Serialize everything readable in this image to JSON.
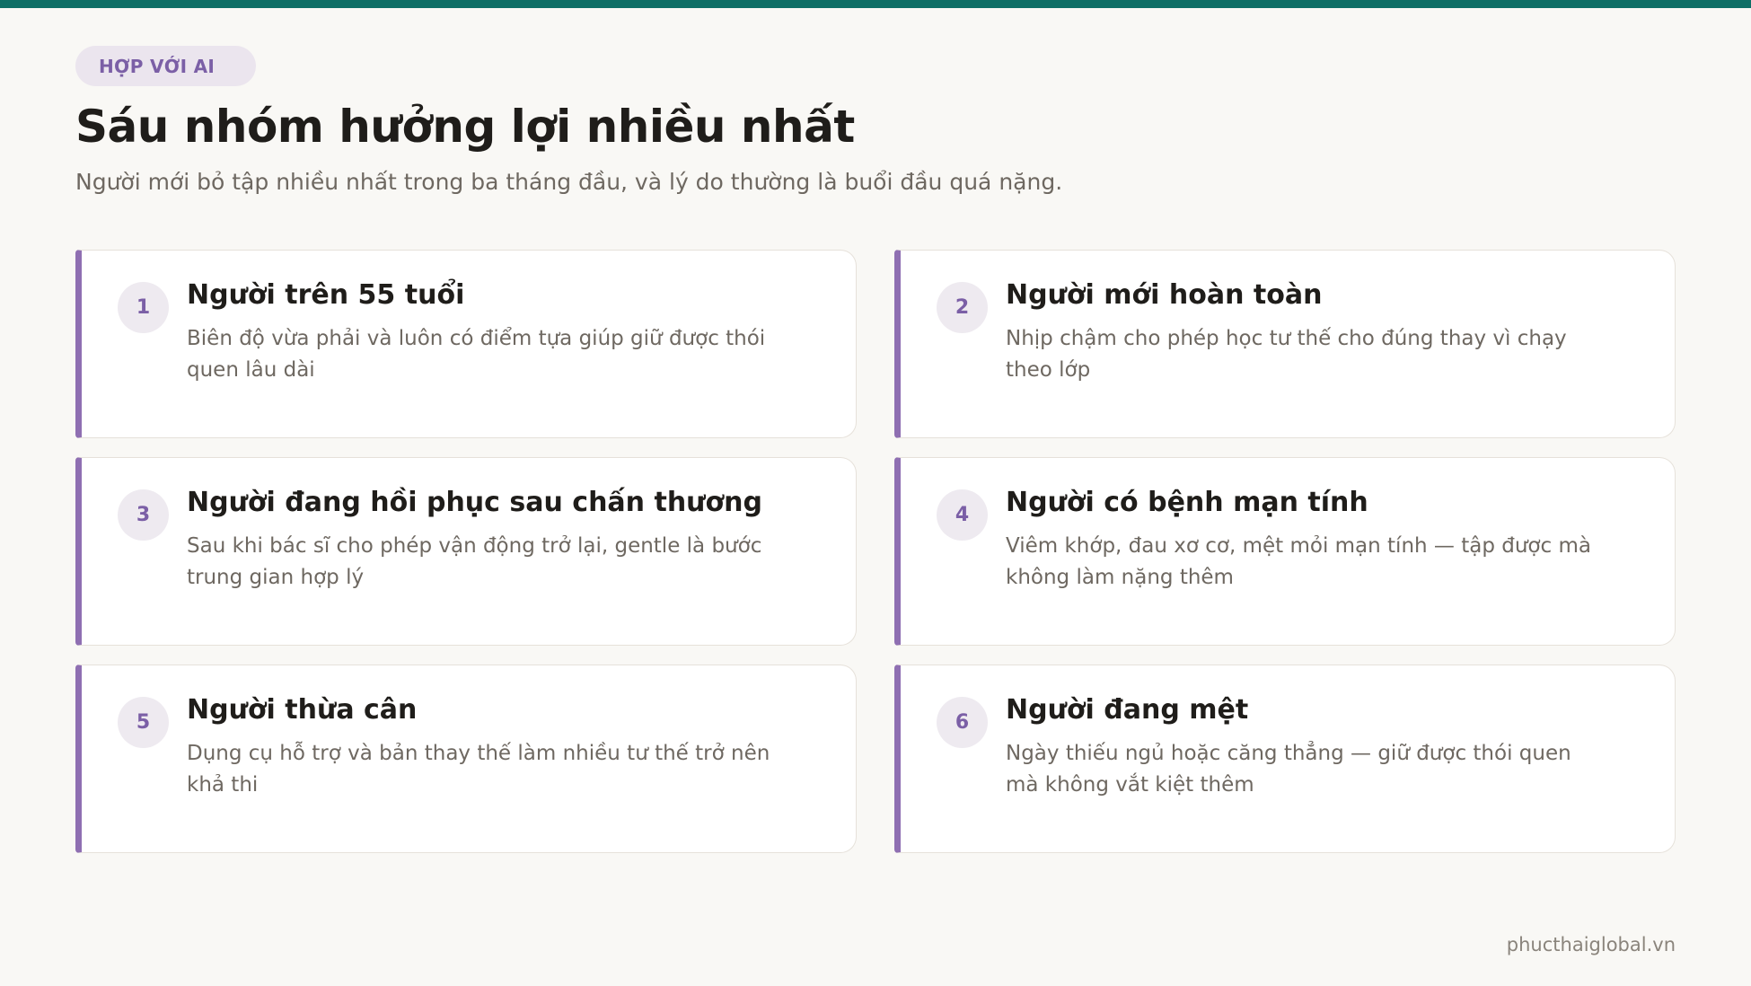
{
  "colors": {
    "top_bar": "#0f6f66",
    "accent": "#8f6fb2",
    "background": "#f9f8f5"
  },
  "badge": "HỢP VỚI AI",
  "title": "Sáu nhóm hưởng lợi nhiều nhất",
  "subtitle": "Người mới bỏ tập nhiều nhất trong ba tháng đầu, và lý do thường là buổi đầu quá nặng.",
  "cards": [
    {
      "num": "1",
      "title": "Người trên 55 tuổi",
      "desc": "Biên độ vừa phải và luôn có điểm tựa giúp giữ được thói quen lâu dài"
    },
    {
      "num": "2",
      "title": "Người mới hoàn toàn",
      "desc": "Nhịp chậm cho phép học tư thế cho đúng thay vì chạy theo lớp"
    },
    {
      "num": "3",
      "title": "Người đang hồi phục sau chấn thương",
      "desc": "Sau khi bác sĩ cho phép vận động trở lại, gentle là bước trung gian hợp lý"
    },
    {
      "num": "4",
      "title": "Người có bệnh mạn tính",
      "desc": "Viêm khớp, đau xơ cơ, mệt mỏi mạn tính — tập được mà không làm nặng thêm"
    },
    {
      "num": "5",
      "title": "Người thừa cân",
      "desc": "Dụng cụ hỗ trợ và bản thay thế làm nhiều tư thế trở nên khả thi"
    },
    {
      "num": "6",
      "title": "Người đang mệt",
      "desc": "Ngày thiếu ngủ hoặc căng thẳng — giữ được thói quen mà không vắt kiệt thêm"
    }
  ],
  "footer": "phucthaiglobal.vn"
}
